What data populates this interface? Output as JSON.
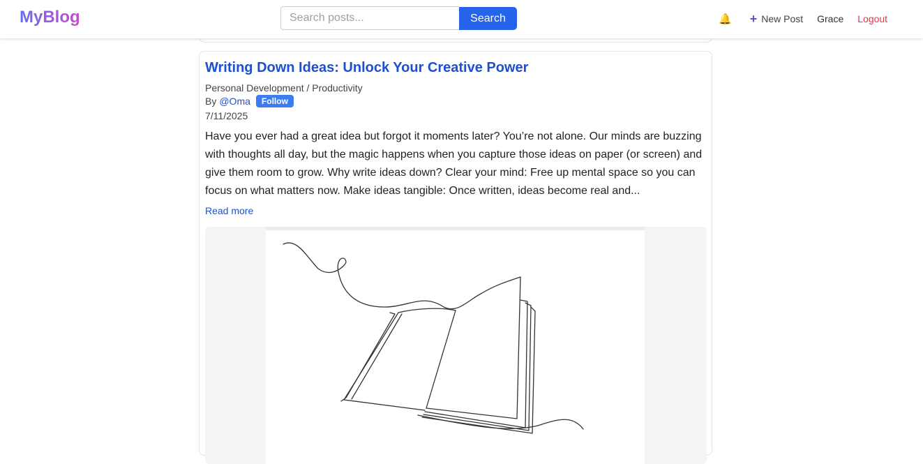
{
  "brand": {
    "logo": "MyBlog"
  },
  "search": {
    "placeholder": "Search posts...",
    "button": "Search"
  },
  "nav": {
    "bell_icon": "bell-icon",
    "new_post": "New Post",
    "user": "Grace",
    "logout": "Logout"
  },
  "post": {
    "title": "Writing Down Ideas: Unlock Your Creative Power",
    "category": "Personal Development / Productivity",
    "by": "By",
    "author": "@Oma",
    "follow": "Follow",
    "date": "7/11/2025",
    "excerpt": "Have you ever had a great idea but forgot it moments later? You’re not alone. Our minds are buzzing with thoughts all day, but the magic happens when you capture those ideas on paper (or screen) and give them room to grow. Why write ideas down? Clear your mind: Free up mental space so you can focus on what matters now. Make ideas tangible: Once written, ideas become real and...",
    "read_more": "Read more"
  },
  "colors": {
    "accent": "#2563eb",
    "link": "#1d4fd1",
    "logout": "#e0374a",
    "follow_bg": "#3b7cf0"
  }
}
